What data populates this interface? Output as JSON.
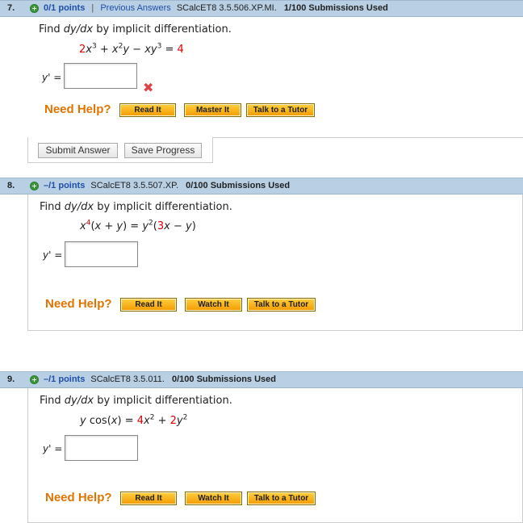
{
  "questions": [
    {
      "number": "7.",
      "points": "0/1 points",
      "separator": "|",
      "previous_answers": "Previous Answers",
      "code": "SCalcET8 3.5.506.XP.MI.",
      "submissions": "1/100 Submissions Used",
      "prompt_pre": "Find ",
      "prompt_var": "dy/dx",
      "prompt_post": " by implicit differentiation.",
      "yprime_label": "y' =",
      "answer_value": "",
      "help_label": "Need Help?",
      "buttons": [
        "Read It",
        "Master It",
        "Talk to a Tutor"
      ],
      "submit_label": "Submit Answer",
      "save_label": "Save Progress"
    },
    {
      "number": "8.",
      "points": "–/1 points",
      "code": "SCalcET8 3.5.507.XP.",
      "submissions": "0/100 Submissions Used",
      "prompt_pre": "Find ",
      "prompt_var": "dy/dx",
      "prompt_post": " by implicit differentiation.",
      "yprime_label": "y' =",
      "answer_value": "",
      "help_label": "Need Help?",
      "buttons": [
        "Read It",
        "Watch It",
        "Talk to a Tutor"
      ]
    },
    {
      "number": "9.",
      "points": "–/1 points",
      "code": "SCalcET8 3.5.011.",
      "submissions": "0/100 Submissions Used",
      "prompt_pre": "Find  ",
      "prompt_var": "dy/dx",
      "prompt_post": "  by implicit differentiation.",
      "yprime_label": "y' =",
      "answer_value": "",
      "help_label": "Need Help?",
      "buttons": [
        "Read It",
        "Watch It",
        "Talk to a Tutor"
      ]
    }
  ],
  "colors": {
    "header_bg": "#b8cfe4",
    "points_link": "#1f4fa8",
    "help_orange": "#e07400",
    "red": "#dd0000"
  },
  "icons": [
    "plus-icon",
    "close-icon"
  ]
}
